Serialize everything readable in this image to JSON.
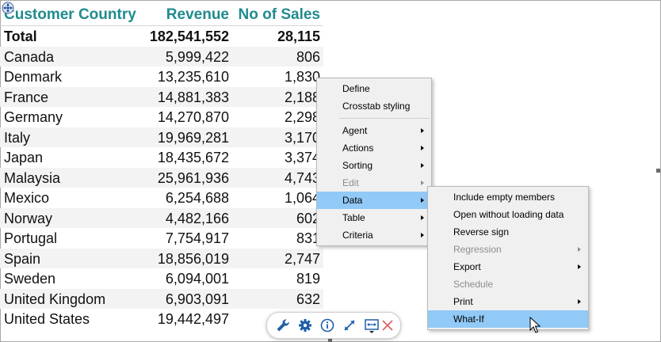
{
  "crosstab": {
    "headers": {
      "country": "Customer Country",
      "revenue": "Revenue",
      "sales": "No of Sales"
    },
    "total": {
      "country": "Total",
      "revenue": "182,541,552",
      "sales": "28,115"
    },
    "rows": [
      {
        "country": "Canada",
        "revenue": "5,999,422",
        "sales": "806"
      },
      {
        "country": "Denmark",
        "revenue": "13,235,610",
        "sales": "1,830"
      },
      {
        "country": "France",
        "revenue": "14,881,383",
        "sales": "2,188"
      },
      {
        "country": "Germany",
        "revenue": "14,270,870",
        "sales": "2,298"
      },
      {
        "country": "Italy",
        "revenue": "19,969,281",
        "sales": "3,170"
      },
      {
        "country": "Japan",
        "revenue": "18,435,672",
        "sales": "3,374"
      },
      {
        "country": "Malaysia",
        "revenue": "25,961,936",
        "sales": "4,743"
      },
      {
        "country": "Mexico",
        "revenue": "6,254,688",
        "sales": "1,064"
      },
      {
        "country": "Norway",
        "revenue": "4,482,166",
        "sales": "602"
      },
      {
        "country": "Portugal",
        "revenue": "7,754,917",
        "sales": "831"
      },
      {
        "country": "Spain",
        "revenue": "18,856,019",
        "sales": "2,747"
      },
      {
        "country": "Sweden",
        "revenue": "6,094,001",
        "sales": "819"
      },
      {
        "country": "United Kingdom",
        "revenue": "6,903,091",
        "sales": "632"
      },
      {
        "country": "United States",
        "revenue": "19,442,497",
        "sales": ""
      }
    ]
  },
  "context_menu": {
    "items": {
      "define": "Define",
      "crosstab_styling": "Crosstab styling",
      "agent": "Agent",
      "actions": "Actions",
      "sorting": "Sorting",
      "edit": "Edit",
      "data": "Data",
      "table": "Table",
      "criteria": "Criteria"
    }
  },
  "data_submenu": {
    "items": {
      "include_empty": "Include empty members",
      "open_without_loading": "Open without loading data",
      "reverse_sign": "Reverse sign",
      "regression": "Regression",
      "export": "Export",
      "schedule": "Schedule",
      "print": "Print",
      "what_if": "What-If"
    }
  },
  "toolbar": {
    "icons": [
      "wrench-icon",
      "gear-icon",
      "info-icon",
      "expand-icon",
      "fit-width-icon",
      "close-icon"
    ]
  },
  "colors": {
    "header_text": "#218b8e",
    "menu_highlight": "#91c9f7",
    "menu_background": "#f0f0f0",
    "toolbar_blue": "#1f5fa8",
    "close_red": "#e05a5a"
  }
}
